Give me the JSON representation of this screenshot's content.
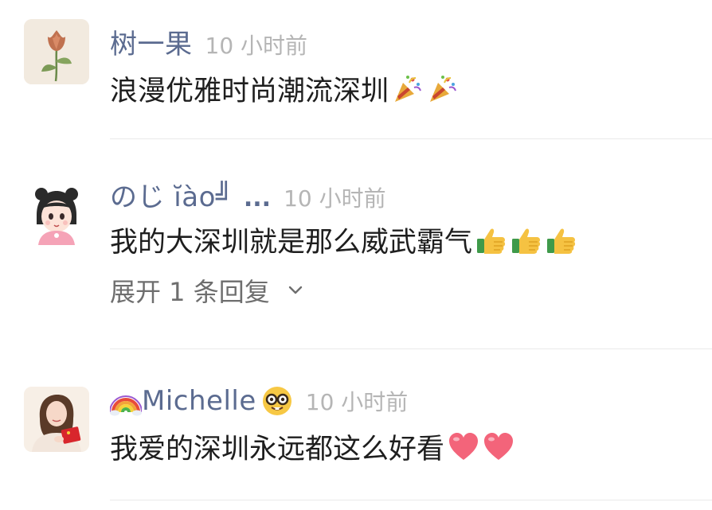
{
  "comments": [
    {
      "username": "树一果",
      "time": "10 小时前",
      "text": "浪漫优雅时尚潮流深圳",
      "emojis": [
        "party-popper-icon",
        "party-popper-icon"
      ]
    },
    {
      "username": "のじ ĭào╝",
      "ellipsis": "...",
      "time": "10 小时前",
      "text": "我的大深圳就是那么威武霸气",
      "emojis": [
        "thumbs-up-icon",
        "thumbs-up-icon",
        "thumbs-up-icon"
      ],
      "expand_label": "展开 1 条回复"
    },
    {
      "username": "Michelle",
      "time": "10 小时前",
      "text": "我爱的深圳永远都这么好看",
      "emojis": [
        "heart-icon",
        "heart-icon"
      ],
      "name_prefix_icon": "rainbow-icon",
      "name_suffix_icon": "nerd-face-icon"
    }
  ],
  "colors": {
    "username": "#5b6b90",
    "time": "#b5b5b5",
    "text": "#1e1e1e",
    "divider": "#e9e9e9"
  }
}
